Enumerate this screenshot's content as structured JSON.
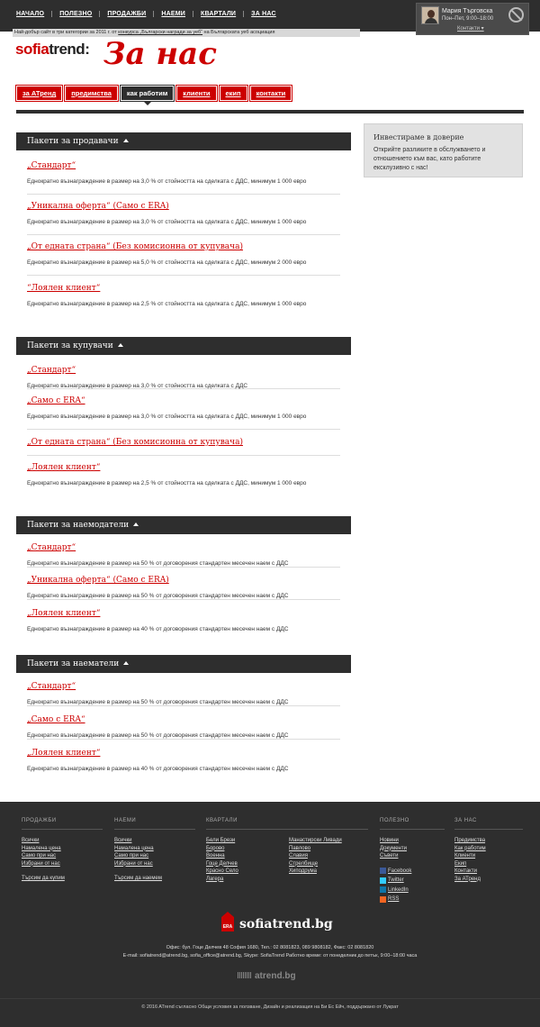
{
  "topnav": [
    "НАЧАЛО",
    "ПОЛЕЗНО",
    "ПРОДАЖБИ",
    "НАЕМИ",
    "КВАРТАЛИ",
    "ЗА НАС"
  ],
  "agent": {
    "name": "Мария Търговска",
    "hours": "Пон–Пет, 9:00–18:00",
    "contacts": "Контакти"
  },
  "award": {
    "pre": "Най-добър сайт в три категории за 2011 г. от ",
    "link": "конкурса „Български награди за уеб“",
    "post": " на Българската уеб асоциация"
  },
  "logo": {
    "so": "sofia",
    "rest": "trend",
    "colon": ":"
  },
  "page_title": "За нас",
  "tabs": [
    {
      "label": "за АТренд",
      "active": false
    },
    {
      "label": "предимства",
      "active": false
    },
    {
      "label": "как работим",
      "active": true
    },
    {
      "label": "клиенти",
      "active": false
    },
    {
      "label": "екип",
      "active": false
    },
    {
      "label": "контакти",
      "active": false
    }
  ],
  "sidebox": {
    "title": "Инвестираме в доверие",
    "text": "Открийте разликите в обслужването и отношението към вас, като работите ексклузивно с нас!"
  },
  "sections": [
    {
      "title": "Пакети за продавачи",
      "packages": [
        {
          "title": "„Стандарт“",
          "desc": "Еднократно възнаграждение в размер на 3,0 % от стойността на сделката с ДДС, минимум 1 000 евро"
        },
        {
          "title": "„Уникална оферта“ (Само с ERA)",
          "desc": "Еднократно възнаграждение в размер на 3,0 % от стойността на сделката с ДДС, минимум 1 000 евро"
        },
        {
          "title": "„От едната страна“ (Без комисионна от купувача)",
          "desc": "Еднократно възнаграждение в размер на 5,0 % от стойността на сделката с ДДС, минимум 2 000 евро"
        },
        {
          "title": "“Лоялен клиент“",
          "desc": "Еднократно възнаграждение в размер на 2,5 % от стойността на сделката с ДДС, минимум 1 000 евро"
        }
      ]
    },
    {
      "title": "Пакети за купувачи",
      "packages": [
        {
          "title": "„Стандарт“",
          "desc": "Еднократно възнаграждение в размер на 3,0 % от стойността на сделката с ДДС"
        },
        {
          "title": "„Само с ERA“",
          "desc": "Еднократно възнаграждение в размер на 3,0 % от стойността на сделката с ДДС, минимум 1 000 евро"
        },
        {
          "title": "„От едната страна“ (Без комисионна от купувача)",
          "desc": ""
        },
        {
          "title": "„Лоялен клиент“",
          "desc": "Еднократно възнаграждение в размер на 2,5 % от стойността на сделката с ДДС, минимум 1 000 евро"
        }
      ]
    },
    {
      "title": "Пакети за наемодатели",
      "packages": [
        {
          "title": "„Стандарт“",
          "desc": "Еднократно възнаграждение в размер на 50 % от договорения стандартен месечен наем с ДДС"
        },
        {
          "title": "„Уникална оферта“ (Само с ERA)",
          "desc": "Еднократно възнаграждение в размер на 50 % от договорения стандартен месечен наем с ДДС"
        },
        {
          "title": "„Лоялен клиент“",
          "desc": "Еднократно възнаграждение в размер на 40 % от договорения стандартен месечен наем с ДДС"
        }
      ]
    },
    {
      "title": "Пакети за наематели",
      "packages": [
        {
          "title": "„Стандарт“",
          "desc": "Еднократно възнаграждение в размер на 50 % от договорения стандартен месечен наем с ДДС"
        },
        {
          "title": "„Само с ERA“",
          "desc": "Еднократно възнаграждение в размер на 50 % от договорения стандартен месечен наем с ДДС"
        },
        {
          "title": "„Лоялен клиент“",
          "desc": "Еднократно възнаграждение в размер на 40 % от договорения стандартен месечен наем с ДДС"
        }
      ]
    }
  ],
  "footer": {
    "sales": {
      "title": "ПРОДАЖБИ",
      "links": [
        "Всички",
        "Намалена цена",
        "Само при нас",
        "Избрани от нас"
      ],
      "extra": "Търсим да купим"
    },
    "rent": {
      "title": "НАЕМИ",
      "links": [
        "Всички",
        "Намалена цена",
        "Само при нас",
        "Избрани от нас"
      ],
      "extra": "Търсим да наемем"
    },
    "districts": {
      "title": "КВАРТАЛИ",
      "col1": [
        "Бели Брези",
        "Борово",
        "Военна",
        "Гоце Делчев",
        "Красно Село",
        "Лагера"
      ],
      "col2": [
        "Манастирски Ливади",
        "Павлово",
        "Славия",
        "Стрелбище",
        "Хиподрума"
      ]
    },
    "useful": {
      "title": "ПОЛЕЗНО",
      "links": [
        "Новини",
        "Документи",
        "Съвети"
      ],
      "social": [
        "Facebook",
        "Twitter",
        "LinkedIn",
        "RSS"
      ]
    },
    "about": {
      "title": "ЗА НАС",
      "links": [
        "Предимства",
        "Как работим",
        "Клиенти",
        "Екип",
        "Контакти",
        "За АТренд"
      ]
    },
    "brand": "sofiatrend.bg",
    "era": "ERA",
    "office": "Офис: бул. Гоце Делчев 48 София 1680, Тел.: 02 8081823, 089 9808182, Факс: 02 8081820",
    "email_line": "E-mail: sofiatrend@atrend.bg, sofia_office@atrend.bg, Skype: SofiaTrend Работно време: от понеделник до петък, 9:00–18:00 часа",
    "atrend": "atrend.bg",
    "copyright": "© 2016 ATrend съгласно Общи условия за ползване, Дизайн и реализация на Би Ес Ейч, поддържано от Лукрат"
  },
  "colors": {
    "brand_red": "#cc0000",
    "dark": "#2e2e2e",
    "facebook": "#3b5998",
    "twitter": "#33ccff",
    "linkedin": "#0e76a8",
    "rss": "#f26522"
  }
}
